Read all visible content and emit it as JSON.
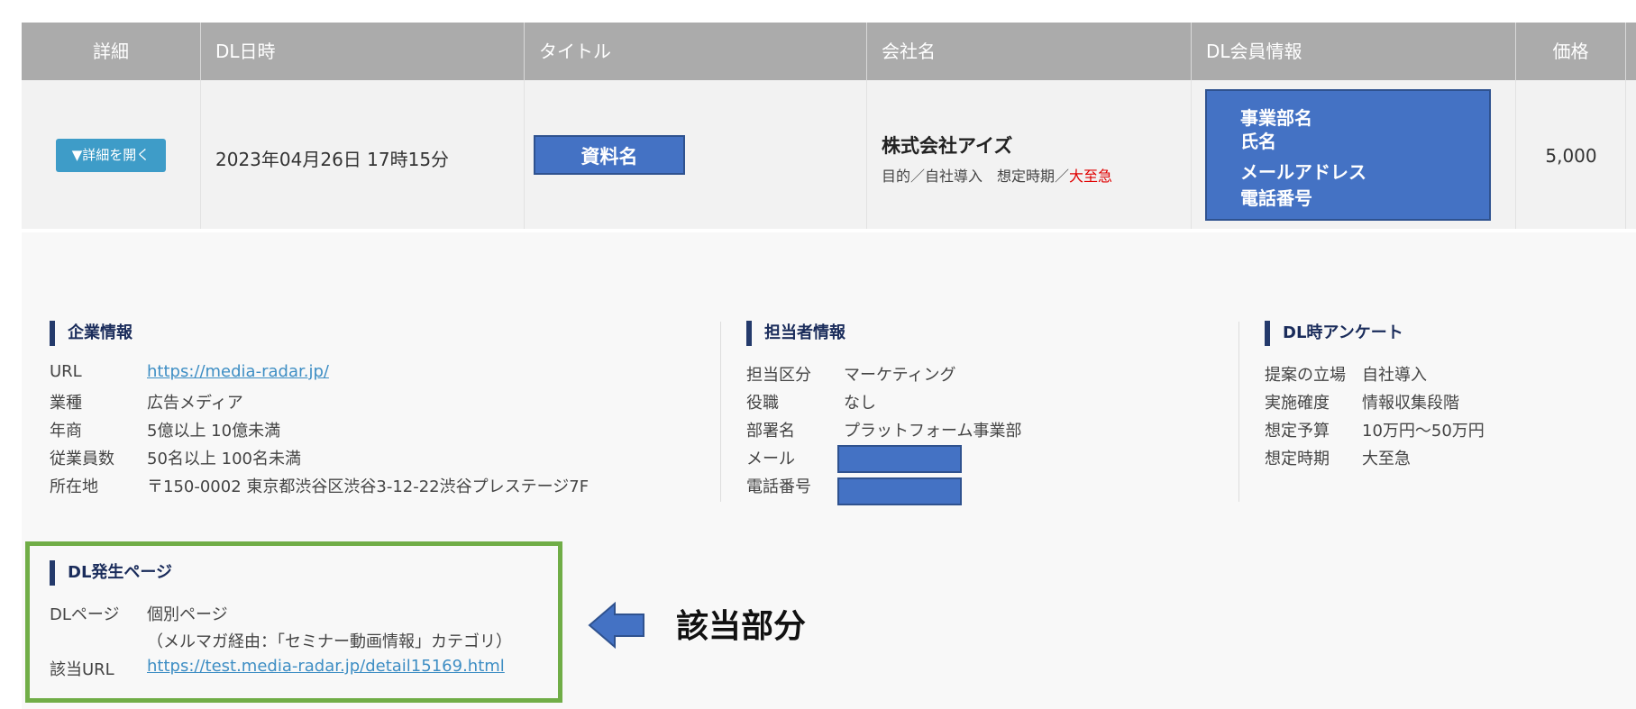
{
  "table": {
    "headers": {
      "detail": "詳細",
      "dl_datetime": "DL日時",
      "title": "タイトル",
      "company": "会社名",
      "member_info": "DL会員情報",
      "price": "価格"
    },
    "row": {
      "open_button": "▼詳細を開く",
      "dl_datetime": "2023年04月26日 17時15分",
      "doc_title": "資料名",
      "company_name": "株式会社アイズ",
      "company_meta_prefix": "目的／自社導入　想定時期／",
      "company_meta_urgent": "大至急",
      "member_lines": [
        "事業部名",
        "氏名",
        "メールアドレス",
        "電話番号"
      ],
      "price": "5,000"
    }
  },
  "company_info": {
    "title": "企業情報",
    "rows": [
      {
        "key": "URL",
        "value": "https://media-radar.jp/"
      },
      {
        "key": "業種",
        "value": "広告メディア"
      },
      {
        "key": "年商",
        "value": "5億以上 10億未満"
      },
      {
        "key": "従業員数",
        "value": "50名以上 100名未満"
      },
      {
        "key": "所在地",
        "value": "〒150-0002 東京都渋谷区渋谷3-12-22渋谷プレステージ7F"
      }
    ]
  },
  "contact_info": {
    "title": "担当者情報",
    "rows": [
      {
        "key": "担当区分",
        "value": "マーケティング"
      },
      {
        "key": "役職",
        "value": "なし"
      },
      {
        "key": "部署名",
        "value": "プラットフォーム事業部"
      },
      {
        "key": "メール",
        "value": ""
      },
      {
        "key": "電話番号",
        "value": ""
      }
    ]
  },
  "survey": {
    "title": "DL時アンケート",
    "rows": [
      {
        "key": "提案の立場",
        "value": "自社導入"
      },
      {
        "key": "実施確度",
        "value": "情報収集段階"
      },
      {
        "key": "想定予算",
        "value": "10万円〜50万円"
      },
      {
        "key": "想定時期",
        "value": "大至急"
      }
    ]
  },
  "dl_page": {
    "title": "DL発生ページ",
    "page_key": "DLページ",
    "page_value_1": "個別ページ",
    "page_value_2": "（メルマガ経由：「セミナー動画情報」カテゴリ）",
    "url_key": "該当URL",
    "url_value": "https://test.media-radar.jp/detail15169.html"
  },
  "annotation": {
    "label": "該当部分",
    "arrow_color": "#4472c4",
    "frame_color": "#70ad47"
  }
}
